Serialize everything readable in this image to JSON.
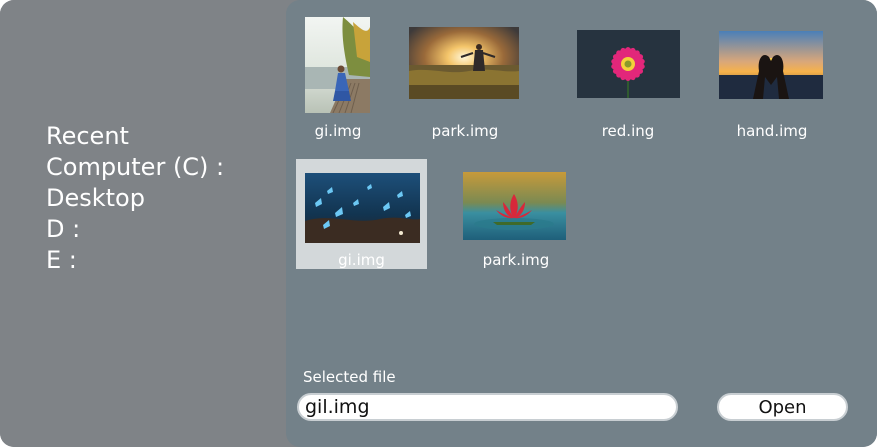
{
  "sidebar": {
    "items": [
      {
        "label": "Recent"
      },
      {
        "label": "Computer (C) :"
      },
      {
        "label": "Desktop"
      },
      {
        "label": "D :"
      },
      {
        "label": "E :"
      }
    ]
  },
  "files": [
    {
      "name": "gi.img",
      "thumb": "woman-by-lake-photo"
    },
    {
      "name": "park.img",
      "thumb": "sunset-field-photo"
    },
    {
      "name": "red.ing",
      "thumb": "pink-flower-photo"
    },
    {
      "name": "hand.img",
      "thumb": "heart-hands-photo"
    },
    {
      "name": "gi.img",
      "thumb": "blue-butterflies-photo",
      "selected": true
    },
    {
      "name": "park.img",
      "thumb": "lotus-flower-photo"
    }
  ],
  "footer": {
    "selected_label": "Selected file",
    "selected_value": "gil.img",
    "open_label": "Open"
  },
  "colors": {
    "sidebar_bg": "#7f8387",
    "main_bg": "#738189",
    "selected_tile": "#d3d8da",
    "text": "#ffffff"
  }
}
